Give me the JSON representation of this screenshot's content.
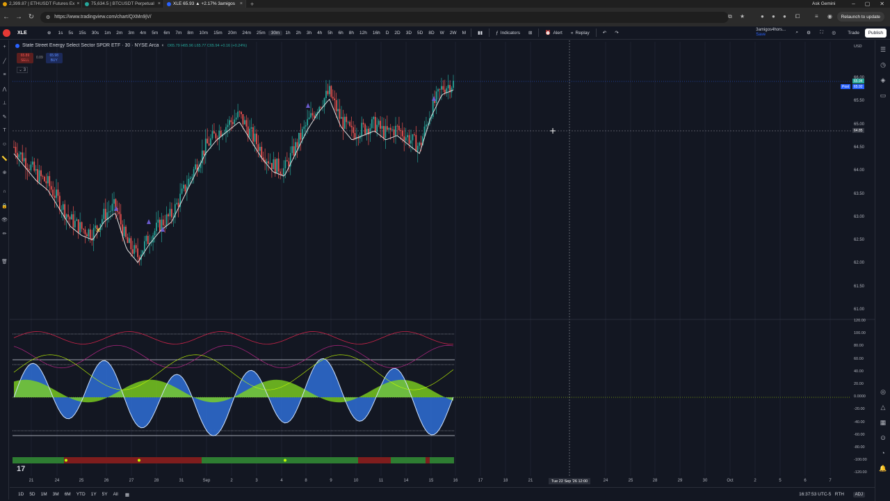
{
  "browser": {
    "tabs": [
      {
        "label": "2,399.87 | ETHUSDT Futures Ex",
        "color": "#e3a008",
        "active": false
      },
      {
        "label": "75,634.5 | BTCUSDT Perpetual",
        "color": "#26a69a",
        "active": false
      },
      {
        "label": "XLE 65.93 ▲ +2.17% 3amigos",
        "color": "#2962ff",
        "active": true
      }
    ],
    "ask_gemini": "Ask Gemini",
    "url": "https://www.tradingview.com/chart/QXMn9jV/",
    "relaunch": "Relaunch to update"
  },
  "toolbar": {
    "symbol": "XLE",
    "intervals": [
      "1s",
      "5s",
      "15s",
      "30s",
      "1m",
      "2m",
      "3m",
      "4m",
      "5m",
      "6m",
      "7m",
      "8m",
      "10m",
      "15m",
      "20m",
      "24m",
      "25m",
      "30m",
      "1h",
      "2h",
      "3h",
      "4h",
      "5h",
      "6h",
      "8h",
      "12h",
      "16h",
      "D",
      "2D",
      "3D",
      "5D",
      "8D",
      "W",
      "2W",
      "M"
    ],
    "selected_interval": "30m",
    "indicators": "Indicators",
    "alert": "Alert",
    "replay": "Replay",
    "layout_name": "3amigos4hors...",
    "layout_sub": "Save",
    "trade": "Trade",
    "publish": "Publish"
  },
  "legend": {
    "title": "State Street Energy Select Sector SPDR ETF · 30 · NYSE Arca",
    "ohlc": "O65.79 H65.96 L65.77 C65.94 +0.16 (+0.24%)",
    "sell_price": "65.89",
    "sell_label": "SELL",
    "spread": "0.09",
    "buy_price": "65.98",
    "buy_label": "BUY",
    "count": "3"
  },
  "price_axis": {
    "currency": "USD",
    "labels": [
      "66.00",
      "65.50",
      "65.00",
      "64.50",
      "64.00",
      "63.50",
      "63.00",
      "62.50",
      "62.00",
      "61.50",
      "61.00"
    ],
    "last_price": "65.94",
    "post_label": "Post",
    "post_price": "65.92",
    "crosshair_price": "64.85"
  },
  "indicator_axis": {
    "labels": [
      "120.00",
      "100.00",
      "80.00",
      "60.00",
      "40.00",
      "20.00",
      "0.0000",
      "-20.00",
      "-40.00",
      "-60.00",
      "-80.00",
      "-100.00",
      "-120.00"
    ]
  },
  "time_axis": {
    "labels": [
      {
        "t": "21",
        "x": 45
      },
      {
        "t": "24",
        "x": 82
      },
      {
        "t": "25",
        "x": 117
      },
      {
        "t": "26",
        "x": 153
      },
      {
        "t": "27",
        "x": 189
      },
      {
        "t": "28",
        "x": 225
      },
      {
        "t": "31",
        "x": 261
      },
      {
        "t": "Sep",
        "x": 297
      },
      {
        "t": "2",
        "x": 333
      },
      {
        "t": "3",
        "x": 369
      },
      {
        "t": "4",
        "x": 405
      },
      {
        "t": "8",
        "x": 440
      },
      {
        "t": "9",
        "x": 476
      },
      {
        "t": "10",
        "x": 512
      },
      {
        "t": "11",
        "x": 548
      },
      {
        "t": "14",
        "x": 584
      },
      {
        "t": "15",
        "x": 620
      },
      {
        "t": "16",
        "x": 655
      },
      {
        "t": "17",
        "x": 691
      },
      {
        "t": "18",
        "x": 727
      },
      {
        "t": "21",
        "x": 763
      },
      {
        "t": "24",
        "x": 871
      },
      {
        "t": "25",
        "x": 907
      },
      {
        "t": "28",
        "x": 942
      },
      {
        "t": "29",
        "x": 978
      },
      {
        "t": "30",
        "x": 1014
      },
      {
        "t": "Oct",
        "x": 1050
      },
      {
        "t": "2",
        "x": 1086
      },
      {
        "t": "5",
        "x": 1122
      },
      {
        "t": "6",
        "x": 1158
      },
      {
        "t": "7",
        "x": 1194
      }
    ],
    "crosshair_time": "Tue 22 Sep '26  12:00"
  },
  "bottom": {
    "ranges": [
      "1D",
      "5D",
      "1M",
      "3M",
      "6M",
      "YTD",
      "1Y",
      "5Y",
      "All"
    ],
    "clock": "16:37:53 UTC-5",
    "session": "RTH",
    "adj": "ADJ"
  },
  "chart_data": {
    "type": "line",
    "series": [
      {
        "values": [
          64.6,
          64.3,
          64.0,
          63.8,
          63.4,
          63.0,
          62.8,
          62.7,
          63.1,
          63.3,
          62.5,
          62.2,
          62.6,
          62.9,
          63.1,
          63.6,
          64.1,
          64.6,
          64.9,
          65.1,
          65.3,
          64.9,
          64.5,
          64.2,
          64.1,
          64.6,
          65.1,
          65.5,
          65.8,
          65.2,
          64.9,
          65.0,
          65.1,
          64.9,
          65.0,
          64.8,
          64.6,
          65.4,
          65.9,
          66.0
        ]
      }
    ],
    "ylim": [
      61.0,
      66.1
    ],
    "colors": {
      "up": "#26a69a",
      "down": "#ef5350",
      "ma": "#e0e0e0"
    }
  }
}
